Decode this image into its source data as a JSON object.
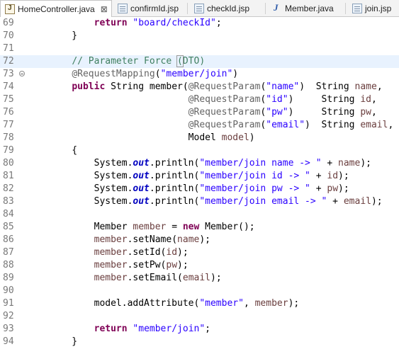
{
  "tabs": [
    {
      "label": "HomeController.java",
      "icon": "java-file-icon",
      "active": true
    },
    {
      "label": "confirmId.jsp",
      "icon": "jsp-file-icon"
    },
    {
      "label": "checkId.jsp",
      "icon": "jsp-file-icon"
    },
    {
      "label": "Member.java",
      "icon": "java-class-icon"
    },
    {
      "label": "join.jsp",
      "icon": "jsp-file-icon"
    }
  ],
  "editor": {
    "current_line": 72,
    "lines": [
      {
        "n": "69",
        "tokens": [
          {
            "t": "        "
          },
          {
            "t": "return",
            "c": "kw"
          },
          {
            "t": " "
          },
          {
            "t": "\"board/checkId\"",
            "c": "str"
          },
          {
            "t": ";"
          }
        ]
      },
      {
        "n": "70",
        "tokens": [
          {
            "t": "    }"
          }
        ]
      },
      {
        "n": "71",
        "tokens": []
      },
      {
        "n": "72",
        "tokens": [
          {
            "t": "    "
          },
          {
            "t": "// Parameter Force ",
            "c": "cm"
          },
          {
            "t": "(",
            "c": "cm br"
          },
          {
            "t": "DTO)",
            "c": "cm"
          }
        ]
      },
      {
        "n": "73",
        "fold": true,
        "tokens": [
          {
            "t": "    "
          },
          {
            "t": "@RequestMapping",
            "c": "ann"
          },
          {
            "t": "("
          },
          {
            "t": "\"member/join\"",
            "c": "str"
          },
          {
            "t": ")"
          }
        ]
      },
      {
        "n": "74",
        "tokens": [
          {
            "t": "    "
          },
          {
            "t": "public",
            "c": "kw"
          },
          {
            "t": " String member("
          },
          {
            "t": "@RequestParam",
            "c": "ann"
          },
          {
            "t": "("
          },
          {
            "t": "\"name\"",
            "c": "str"
          },
          {
            "t": ")  String "
          },
          {
            "t": "name",
            "c": "v"
          },
          {
            "t": ","
          }
        ]
      },
      {
        "n": "75",
        "tokens": [
          {
            "t": "                         "
          },
          {
            "t": "@RequestParam",
            "c": "ann"
          },
          {
            "t": "("
          },
          {
            "t": "\"id\"",
            "c": "str"
          },
          {
            "t": ")     String "
          },
          {
            "t": "id",
            "c": "v"
          },
          {
            "t": ","
          }
        ]
      },
      {
        "n": "76",
        "tokens": [
          {
            "t": "                         "
          },
          {
            "t": "@RequestParam",
            "c": "ann"
          },
          {
            "t": "("
          },
          {
            "t": "\"pw\"",
            "c": "str"
          },
          {
            "t": ")     String "
          },
          {
            "t": "pw",
            "c": "v"
          },
          {
            "t": ","
          }
        ]
      },
      {
        "n": "77",
        "tokens": [
          {
            "t": "                         "
          },
          {
            "t": "@RequestParam",
            "c": "ann"
          },
          {
            "t": "("
          },
          {
            "t": "\"email\"",
            "c": "str"
          },
          {
            "t": ")  String "
          },
          {
            "t": "email",
            "c": "v"
          },
          {
            "t": ","
          }
        ]
      },
      {
        "n": "78",
        "tokens": [
          {
            "t": "                         Model "
          },
          {
            "t": "model",
            "c": "v"
          },
          {
            "t": ")"
          }
        ]
      },
      {
        "n": "79",
        "tokens": [
          {
            "t": "    {"
          }
        ]
      },
      {
        "n": "80",
        "tokens": [
          {
            "t": "        System."
          },
          {
            "t": "out",
            "c": "st"
          },
          {
            "t": ".println("
          },
          {
            "t": "\"member/join name -> \"",
            "c": "str"
          },
          {
            "t": " + "
          },
          {
            "t": "name",
            "c": "v"
          },
          {
            "t": ");"
          }
        ]
      },
      {
        "n": "81",
        "tokens": [
          {
            "t": "        System."
          },
          {
            "t": "out",
            "c": "st"
          },
          {
            "t": ".println("
          },
          {
            "t": "\"member/join id -> \"",
            "c": "str"
          },
          {
            "t": " + "
          },
          {
            "t": "id",
            "c": "v"
          },
          {
            "t": ");"
          }
        ]
      },
      {
        "n": "82",
        "tokens": [
          {
            "t": "        System."
          },
          {
            "t": "out",
            "c": "st"
          },
          {
            "t": ".println("
          },
          {
            "t": "\"member/join pw -> \"",
            "c": "str"
          },
          {
            "t": " + "
          },
          {
            "t": "pw",
            "c": "v"
          },
          {
            "t": ");"
          }
        ]
      },
      {
        "n": "83",
        "tokens": [
          {
            "t": "        System."
          },
          {
            "t": "out",
            "c": "st"
          },
          {
            "t": ".println("
          },
          {
            "t": "\"member/join email -> \"",
            "c": "str"
          },
          {
            "t": " + "
          },
          {
            "t": "email",
            "c": "v"
          },
          {
            "t": ");"
          }
        ]
      },
      {
        "n": "84",
        "tokens": []
      },
      {
        "n": "85",
        "tokens": [
          {
            "t": "        Member "
          },
          {
            "t": "member",
            "c": "v"
          },
          {
            "t": " = "
          },
          {
            "t": "new",
            "c": "kw"
          },
          {
            "t": " Member();"
          }
        ]
      },
      {
        "n": "86",
        "tokens": [
          {
            "t": "        "
          },
          {
            "t": "member",
            "c": "v"
          },
          {
            "t": ".setName("
          },
          {
            "t": "name",
            "c": "v"
          },
          {
            "t": ");"
          }
        ]
      },
      {
        "n": "87",
        "tokens": [
          {
            "t": "        "
          },
          {
            "t": "member",
            "c": "v"
          },
          {
            "t": ".setId("
          },
          {
            "t": "id",
            "c": "v"
          },
          {
            "t": ");"
          }
        ]
      },
      {
        "n": "88",
        "tokens": [
          {
            "t": "        "
          },
          {
            "t": "member",
            "c": "v"
          },
          {
            "t": ".setPw("
          },
          {
            "t": "pw",
            "c": "v"
          },
          {
            "t": ");"
          }
        ]
      },
      {
        "n": "89",
        "tokens": [
          {
            "t": "        "
          },
          {
            "t": "member",
            "c": "v"
          },
          {
            "t": ".setEmail("
          },
          {
            "t": "email",
            "c": "v"
          },
          {
            "t": ");"
          }
        ]
      },
      {
        "n": "90",
        "tokens": []
      },
      {
        "n": "91",
        "tokens": [
          {
            "t": "        model.addAttribute("
          },
          {
            "t": "\"member\"",
            "c": "str"
          },
          {
            "t": ", "
          },
          {
            "t": "member",
            "c": "v"
          },
          {
            "t": ");"
          }
        ]
      },
      {
        "n": "92",
        "tokens": []
      },
      {
        "n": "93",
        "tokens": [
          {
            "t": "        "
          },
          {
            "t": "return",
            "c": "kw"
          },
          {
            "t": " "
          },
          {
            "t": "\"member/join\"",
            "c": "str"
          },
          {
            "t": ";"
          }
        ]
      },
      {
        "n": "94",
        "tokens": [
          {
            "t": "    }"
          }
        ]
      }
    ]
  }
}
